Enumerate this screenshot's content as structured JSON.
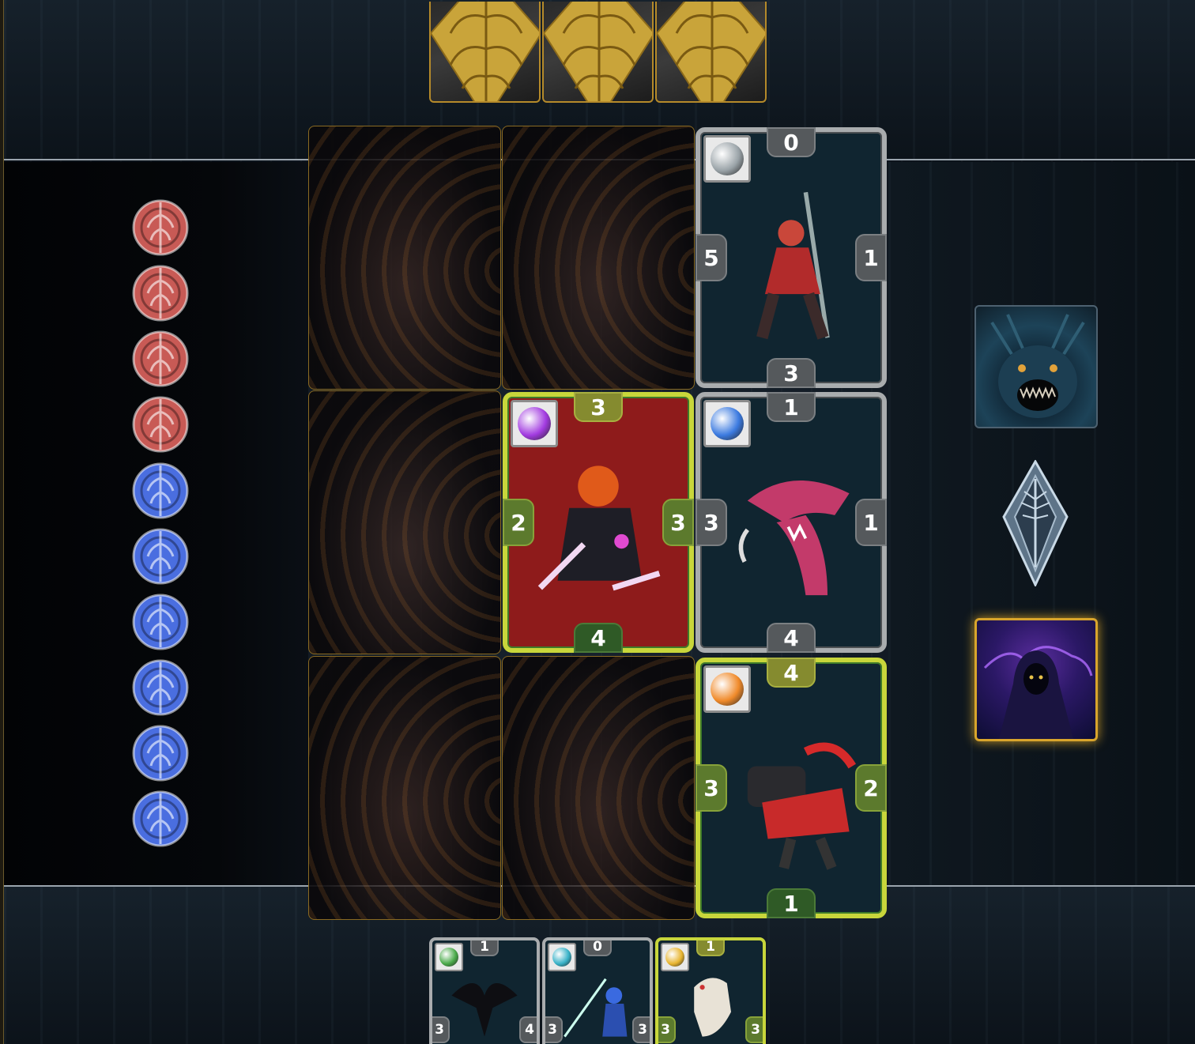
{
  "opponent_hand": {
    "cards": [
      {
        "face": "down"
      },
      {
        "face": "down"
      },
      {
        "face": "down"
      }
    ]
  },
  "score": {
    "red_tokens": 4,
    "blue_tokens": 6,
    "colors": {
      "red": "#c85a55",
      "blue": "#4a6ee0"
    }
  },
  "board": {
    "cards": [
      {
        "cell": "r1c3",
        "owner_color": "gray",
        "element": "stone-element-icon",
        "element_color": "#9aa3a8",
        "top": "0",
        "left": "5",
        "right": "1",
        "bottom": "3",
        "art": "spearman-art",
        "bg": "#102530"
      },
      {
        "cell": "r2c2",
        "owner_color": "lime",
        "element": "void-element-icon",
        "element_color": "#a23be0",
        "top": "3",
        "left": "2",
        "right": "3",
        "bottom": "4",
        "art": "dark-knight-art",
        "bg": "#8e1b1b"
      },
      {
        "cell": "r2c3",
        "owner_color": "gray",
        "element": "water-element-icon",
        "element_color": "#3b7ae0",
        "top": "1",
        "left": "3",
        "right": "1",
        "bottom": "4",
        "art": "shark-beast-art",
        "bg": "#102530"
      },
      {
        "cell": "r3c3",
        "owner_color": "lime",
        "element": "fire-element-icon",
        "element_color": "#f08a2a",
        "top": "4",
        "left": "3",
        "right": "2",
        "bottom": "1",
        "art": "cannon-mech-art",
        "bg": "#102530"
      }
    ],
    "empty_cells": [
      "r1c1",
      "r1c2",
      "r2c1",
      "r3c1",
      "r3c2"
    ]
  },
  "player_hand": {
    "cards": [
      {
        "owner_color": "gray",
        "element": "nature-element-icon",
        "element_color": "#4aaa4a",
        "top": "1",
        "left": "3",
        "right": "4",
        "art": "raven-art"
      },
      {
        "owner_color": "gray",
        "element": "ice-element-icon",
        "element_color": "#38b2c8",
        "top": "0",
        "left": "3",
        "right": "3",
        "art": "trident-warrior-art"
      },
      {
        "owner_color": "lime",
        "element": "light-element-icon",
        "element_color": "#e8b530",
        "top": "1",
        "left": "3",
        "right": "3",
        "art": "bone-dragon-art"
      }
    ]
  },
  "sidebar": {
    "opponent_portrait": "horned-beast-portrait",
    "turn_indicator": "crystal-turn-icon",
    "player_portrait": "hooded-sorcerer-portrait"
  }
}
